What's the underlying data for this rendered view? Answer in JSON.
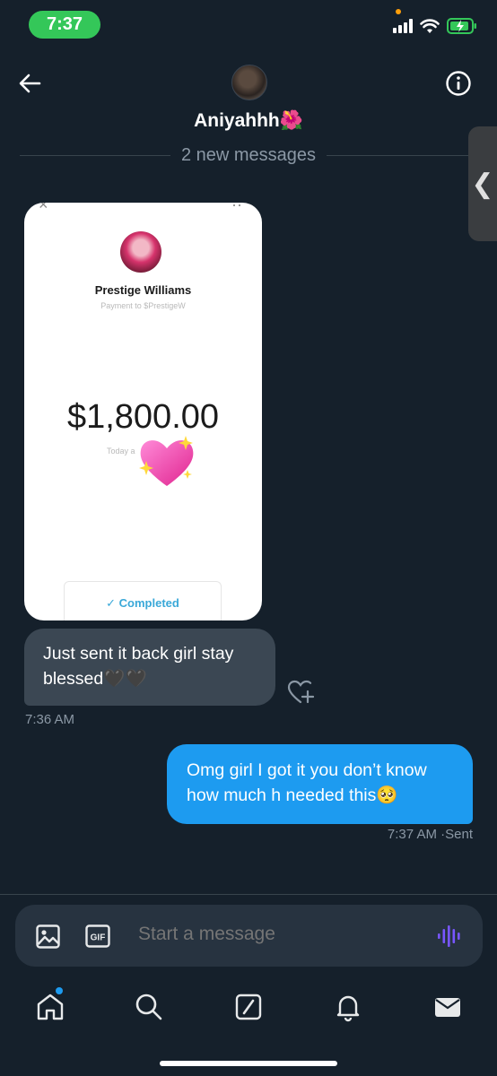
{
  "status_bar": {
    "time": "7:37"
  },
  "header": {
    "contact_name": "Aniyahhh",
    "name_emoji": "🌺",
    "new_messages_label": "2 new messages"
  },
  "messages": {
    "image": {
      "payee_name": "Prestige Williams",
      "payee_subtitle": "Payment to $PrestigeW",
      "amount": "$1,800.00",
      "date_label": "Today a",
      "status_label": "Completed",
      "check_glyph": "✓"
    },
    "received": {
      "text": "Just sent it back girl stay blessed🖤🖤",
      "time": "7:36 AM"
    },
    "sent": {
      "text": "Omg girl I got it you don’t know how much h needed this🥺",
      "time": "7:37 AM",
      "status": "·Sent"
    }
  },
  "composer": {
    "placeholder": "Start a message"
  },
  "nav": {
    "items": [
      "home-icon",
      "search-icon",
      "grok-icon",
      "notifications-icon",
      "messages-icon"
    ]
  },
  "colors": {
    "background": "#15202b",
    "sent_bubble": "#1d9bf0",
    "received_bubble": "#3b4753",
    "composer": "#273340",
    "accent_voice": "#7856ff",
    "time_pill": "#34c759"
  }
}
